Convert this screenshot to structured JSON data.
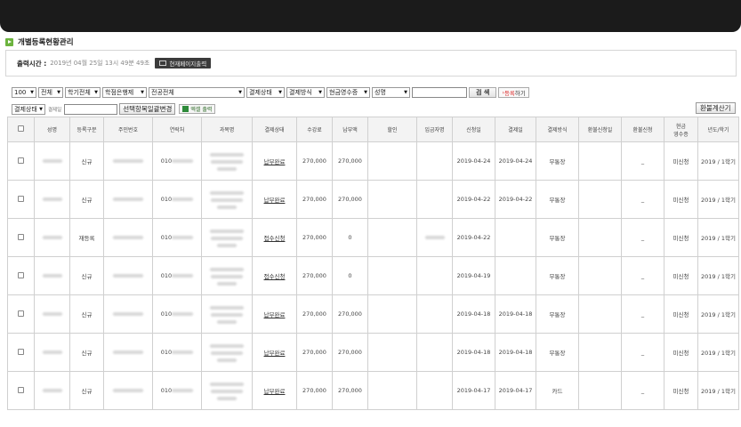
{
  "page": {
    "title": "개별등록현황관리",
    "print_label": "출력시간 :",
    "print_time": "2019년 04월 25일 13시 49분 49초",
    "print_button": "현재페이지출력"
  },
  "filters": {
    "row1": [
      {
        "name": "page-size-select",
        "value": "100",
        "width": 28
      },
      {
        "name": "all-select",
        "value": "전체",
        "width": 28
      },
      {
        "name": "semester-select",
        "value": "학기전체",
        "width": 40
      },
      {
        "name": "bank-select",
        "value": "학점은행제",
        "width": 50
      },
      {
        "name": "major-select",
        "value": "전공전체",
        "width": 108
      },
      {
        "name": "payment-status-select",
        "value": "결제상태",
        "width": 43
      },
      {
        "name": "payment-method-select",
        "value": "결제방식",
        "width": 43
      },
      {
        "name": "cash-receipt-select",
        "value": "현금영수증",
        "width": 49
      },
      {
        "name": "name-field-select",
        "value": "성명",
        "width": 43
      }
    ],
    "search_button": "검 색",
    "register_arrow": "›",
    "register_red": "등록",
    "register_rest": "하기",
    "row2_status_select": "결제상태",
    "row2_label": "결제일",
    "bulk_change_button": "선택항목일괄변경",
    "excel_button": "엑셀 출력",
    "refund_button": "환불계산기"
  },
  "table": {
    "headers": [
      "",
      "성명",
      "등록구분",
      "주민번호",
      "연락처",
      "과목명",
      "결제상태",
      "수강료",
      "납부액",
      "할인",
      "입금자명",
      "신청일",
      "결제일",
      "결제방식",
      "환불신청일",
      "환불신청",
      "현금\n영수증",
      "년도/학기"
    ],
    "rows": [
      {
        "type": "신규",
        "phone": "010",
        "status": "납부완료",
        "fee": "270,000",
        "paid": "270,000",
        "apply": "2019-04-24",
        "paydate": "2019-04-24",
        "method": "무통장",
        "refund": "_",
        "receipt": "미신청",
        "term": "2019 / 1학기",
        "depositor": false
      },
      {
        "type": "신규",
        "phone": "010",
        "status": "납부완료",
        "fee": "270,000",
        "paid": "270,000",
        "apply": "2019-04-22",
        "paydate": "2019-04-22",
        "method": "무통장",
        "refund": "_",
        "receipt": "미신청",
        "term": "2019 / 1학기",
        "depositor": false
      },
      {
        "type": "재등록",
        "phone": "010",
        "status": "접수신청",
        "fee": "270,000",
        "paid": "0",
        "apply": "2019-04-22",
        "paydate": "",
        "method": "무통장",
        "refund": "_",
        "receipt": "미신청",
        "term": "2019 / 1학기",
        "depositor": true
      },
      {
        "type": "신규",
        "phone": "010",
        "status": "접수신청",
        "fee": "270,000",
        "paid": "0",
        "apply": "2019-04-19",
        "paydate": "",
        "method": "무통장",
        "refund": "_",
        "receipt": "미신청",
        "term": "2019 / 1학기",
        "depositor": false
      },
      {
        "type": "신규",
        "phone": "010",
        "status": "납부완료",
        "fee": "270,000",
        "paid": "270,000",
        "apply": "2019-04-18",
        "paydate": "2019-04-18",
        "method": "무통장",
        "refund": "_",
        "receipt": "미신청",
        "term": "2019 / 1학기",
        "depositor": false
      },
      {
        "type": "신규",
        "phone": "010",
        "status": "납부완료",
        "fee": "270,000",
        "paid": "270,000",
        "apply": "2019-04-18",
        "paydate": "2019-04-18",
        "method": "무통장",
        "refund": "_",
        "receipt": "미신청",
        "term": "2019 / 1학기",
        "depositor": false
      },
      {
        "type": "신규",
        "phone": "010",
        "status": "납부완료",
        "fee": "270,000",
        "paid": "270,000",
        "apply": "2019-04-17",
        "paydate": "2019-04-17",
        "method": "카드",
        "refund": "_",
        "receipt": "미신청",
        "term": "2019 / 1학기",
        "depositor": false
      }
    ]
  }
}
